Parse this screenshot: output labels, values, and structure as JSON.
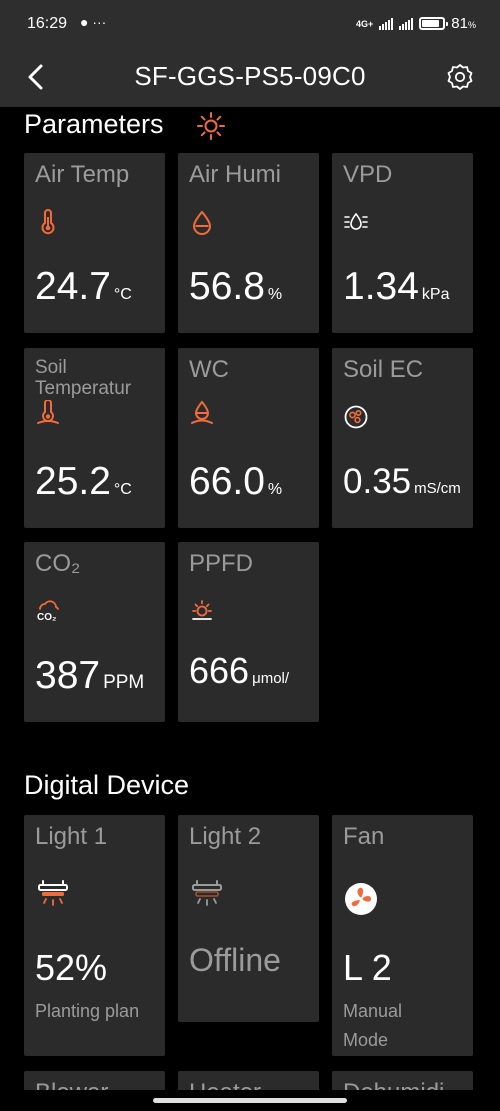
{
  "status": {
    "time": "16:29",
    "left_icons": "● ···",
    "network": "4G+",
    "battery_percent": 81,
    "battery_label": "81",
    "battery_unit": "%"
  },
  "header": {
    "title": "SF-GGS-PS5-09C0"
  },
  "parameters": {
    "title": "Parameters",
    "cards": [
      {
        "label": "Air Temp",
        "value": "24.7",
        "unit": "°C",
        "icon": "thermometer-icon"
      },
      {
        "label": "Air Humi",
        "value": "56.8",
        "unit": "%",
        "icon": "droplet-icon"
      },
      {
        "label": "VPD",
        "value": "1.34",
        "unit": "kPa",
        "icon": "vpd-icon"
      },
      {
        "label": "Soil\nTemperatur",
        "value": "25.2",
        "unit": "°C",
        "icon": "soil-thermometer-icon"
      },
      {
        "label": "WC",
        "value": "66.0",
        "unit": "%",
        "icon": "soil-water-icon"
      },
      {
        "label": "Soil EC",
        "value": "0.35",
        "unit": "mS/cm",
        "icon": "soil-ec-icon"
      },
      {
        "label": "CO₂",
        "value": "387",
        "unit": "PPM",
        "icon": "co2-cloud-icon"
      },
      {
        "label": "PPFD",
        "value": "666",
        "unit": "μmol/",
        "icon": "sunrise-icon"
      }
    ]
  },
  "devices": {
    "title": "Digital Device",
    "cards": [
      {
        "label": "Light 1",
        "value": "52%",
        "sub": "Planting plan",
        "icon": "grow-light-icon"
      },
      {
        "label": "Light 2",
        "value": "Offline",
        "sub": "",
        "icon": "grow-light-icon"
      },
      {
        "label": "Fan",
        "value": "L 2",
        "sub": "Manual\nMode",
        "icon": "fan-icon"
      },
      {
        "label": "Blower"
      },
      {
        "label": "Heater"
      },
      {
        "label": "Dehumidi"
      }
    ]
  },
  "colors": {
    "accent": "#f26b3a",
    "card_bg": "#2b2b2b",
    "label_gray": "#9b9b9b",
    "bar_bg": "#2e2e2e"
  }
}
